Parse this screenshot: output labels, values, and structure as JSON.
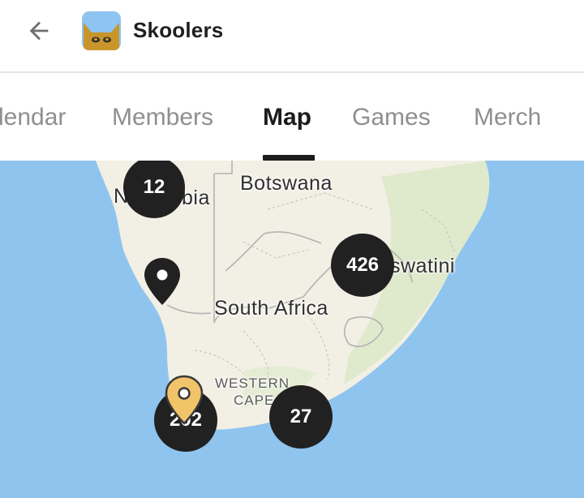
{
  "header": {
    "title": "Skoolers",
    "back_icon": "arrow-left-icon",
    "logo_icon": "cat-logo-icon",
    "logo_color": "#c8952b"
  },
  "tabs": [
    {
      "label": "lendar",
      "active": false
    },
    {
      "label": "Members",
      "active": false
    },
    {
      "label": "Map",
      "active": true
    },
    {
      "label": "Games",
      "active": false
    },
    {
      "label": "Merch",
      "active": false
    }
  ],
  "map": {
    "labels": {
      "namibia_left": "N",
      "namibia_right": "bia",
      "botswana": "Botswana",
      "eswatini": "swatini",
      "south_africa": "South Africa",
      "western": "WESTERN",
      "cape": "CAPE"
    },
    "clusters": [
      {
        "id": "namibia",
        "count": "12"
      },
      {
        "id": "eswatini",
        "count": "426"
      },
      {
        "id": "cape-town",
        "count": "202"
      },
      {
        "id": "south-coast",
        "count": "27"
      }
    ],
    "pins": [
      {
        "id": "west-coast",
        "color": "#212121",
        "icon": "map-pin-icon"
      },
      {
        "id": "cape-selected",
        "color": "#f2c46a",
        "icon": "map-pin-icon"
      }
    ],
    "colors": {
      "ocean": "#8fc4ee",
      "land": "#f2efe4",
      "green": "#dfe9cc",
      "cluster": "#212121"
    }
  }
}
